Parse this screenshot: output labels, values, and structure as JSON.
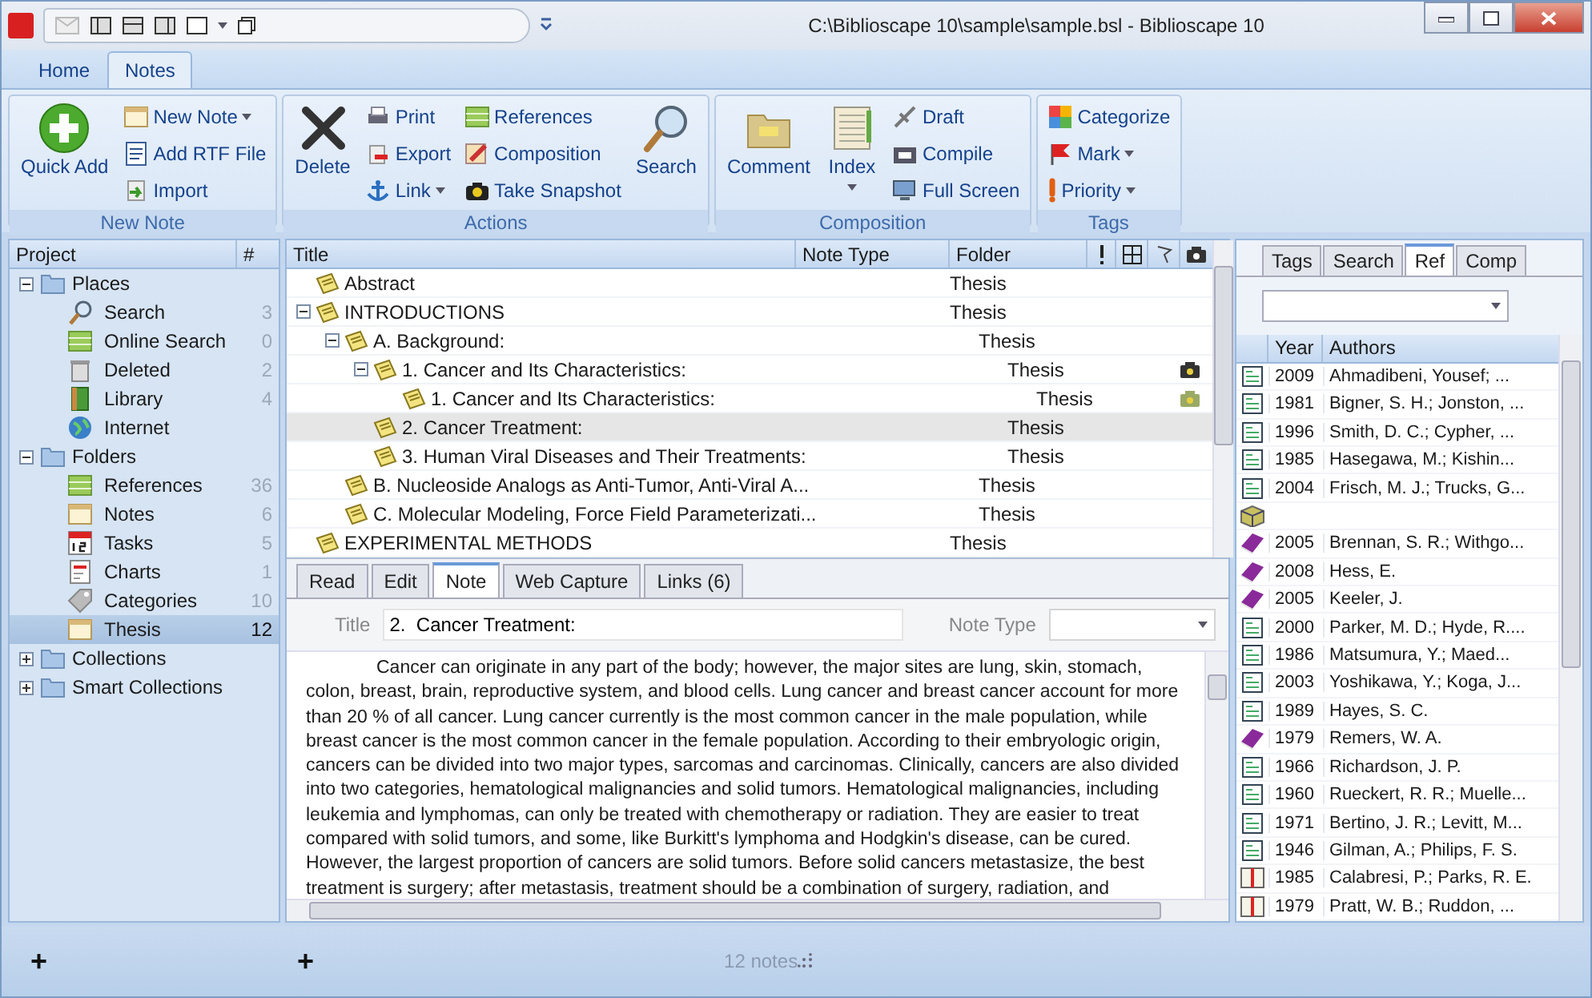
{
  "window": {
    "title": "C:\\Biblioscape 10\\sample\\sample.bsl - Biblioscape 10"
  },
  "ribbon": {
    "tabs": [
      {
        "label": "Home",
        "selected": false
      },
      {
        "label": "Notes",
        "selected": true
      }
    ],
    "groups": [
      {
        "label": "New Note",
        "items": [
          {
            "label": "Quick Add",
            "kind": "large",
            "dropdown": false
          },
          {
            "label": "New Note",
            "kind": "small",
            "dropdown": true
          },
          {
            "label": "Add RTF File",
            "kind": "small",
            "dropdown": false
          },
          {
            "label": "Import",
            "kind": "small",
            "dropdown": false
          }
        ]
      },
      {
        "label": "Actions",
        "items": [
          {
            "label": "Delete",
            "kind": "large",
            "dropdown": false
          },
          {
            "label": "Print",
            "kind": "small",
            "dropdown": false
          },
          {
            "label": "Export",
            "kind": "small",
            "dropdown": false
          },
          {
            "label": "Link",
            "kind": "small",
            "dropdown": true
          },
          {
            "label": "References",
            "kind": "small",
            "dropdown": false
          },
          {
            "label": "Composition",
            "kind": "small",
            "dropdown": false
          },
          {
            "label": "Take Snapshot",
            "kind": "small",
            "dropdown": false
          },
          {
            "label": "Search",
            "kind": "large",
            "dropdown": false
          }
        ]
      },
      {
        "label": "Composition",
        "items": [
          {
            "label": "Comment",
            "kind": "large",
            "dropdown": false
          },
          {
            "label": "Index",
            "kind": "large",
            "dropdown": true
          },
          {
            "label": "Draft",
            "kind": "small",
            "dropdown": false
          },
          {
            "label": "Compile",
            "kind": "small",
            "dropdown": false
          },
          {
            "label": "Full Screen",
            "kind": "small",
            "dropdown": false
          }
        ]
      },
      {
        "label": "Tags",
        "items": [
          {
            "label": "Categorize",
            "kind": "small",
            "dropdown": false
          },
          {
            "label": "Mark",
            "kind": "small",
            "dropdown": true
          },
          {
            "label": "Priority",
            "kind": "small",
            "dropdown": true
          }
        ]
      }
    ]
  },
  "project": {
    "columns": [
      "Project",
      "#"
    ],
    "tree": [
      {
        "label": "Places",
        "expanded": true,
        "children": [
          {
            "label": "Search",
            "kind": "search",
            "count": "3",
            "selected": false
          },
          {
            "label": "Online Search",
            "kind": "online",
            "count": "0",
            "selected": false
          },
          {
            "label": "Deleted",
            "kind": "deleted",
            "count": "2",
            "selected": false
          },
          {
            "label": "Library",
            "kind": "library",
            "count": "4",
            "selected": false
          },
          {
            "label": "Internet",
            "kind": "internet",
            "selected": false
          }
        ]
      },
      {
        "label": "Folders",
        "expanded": true,
        "children": [
          {
            "label": "References",
            "kind": "references",
            "count": "36",
            "selected": false
          },
          {
            "label": "Notes",
            "kind": "notes",
            "count": "6",
            "selected": false
          },
          {
            "label": "Tasks",
            "kind": "tasks",
            "count": "5",
            "selected": false
          },
          {
            "label": "Charts",
            "kind": "charts",
            "count": "1",
            "selected": false
          },
          {
            "label": "Categories",
            "kind": "categories",
            "count": "10",
            "selected": false
          },
          {
            "label": "Thesis",
            "kind": "notes",
            "count": "12",
            "selected": true
          }
        ]
      },
      {
        "label": "Collections",
        "expanded": false
      },
      {
        "label": "Smart Collections",
        "expanded": false
      }
    ]
  },
  "notes_table": {
    "columns": [
      "Title",
      "Note Type",
      "Folder"
    ],
    "rows": [
      {
        "title": "Abstract",
        "folder": "Thesis",
        "selected": false
      },
      {
        "title": "INTRODUCTIONS",
        "folder": "Thesis",
        "selected": false,
        "expanded": true,
        "children": [
          {
            "title": "A.  Background:",
            "folder": "Thesis",
            "selected": false,
            "expanded": true,
            "children": [
              {
                "title": "1.  Cancer and Its Characteristics:",
                "folder": "Thesis",
                "selected": false,
                "snapshot": true,
                "snapshot_dimmed": false,
                "expanded": true,
                "children": [
                  {
                    "title": "1.  Cancer and Its Characteristics:",
                    "folder": "Thesis",
                    "selected": false,
                    "snapshot": true,
                    "snapshot_dimmed": true
                  }
                ]
              },
              {
                "title": "2.  Cancer Treatment:",
                "folder": "Thesis",
                "selected": true
              },
              {
                "title": "3.  Human Viral Diseases and Their Treatments:",
                "folder": "Thesis",
                "selected": false
              }
            ]
          },
          {
            "title": "B.  Nucleoside Analogs as Anti-Tumor, Anti-Viral A...",
            "folder": "Thesis",
            "selected": false
          },
          {
            "title": "C.  Molecular Modeling, Force Field Parameterizati...",
            "folder": "Thesis",
            "selected": false
          }
        ]
      },
      {
        "title": "EXPERIMENTAL METHODS",
        "folder": "Thesis",
        "selected": false
      }
    ]
  },
  "editor": {
    "tabs": [
      {
        "label": "Read",
        "selected": false
      },
      {
        "label": "Edit",
        "selected": false
      },
      {
        "label": "Note",
        "selected": true
      },
      {
        "label": "Web Capture",
        "selected": false
      },
      {
        "label": "Links (6)",
        "selected": false
      }
    ],
    "title_label": "Title",
    "title_value": "2.  Cancer Treatment:",
    "note_type_label": "Note Type",
    "body": "Cancer can originate in any part of the body; however, the major sites are lung, skin, stomach, colon, breast, brain, reproductive system, and blood cells. Lung cancer and breast cancer account for more than 20 % of all cancer. Lung cancer currently is the most common cancer in the male population, while breast cancer is the most common cancer in the female population. According to their embryologic origin, cancers can be divided into two major types, sarcomas and carcinomas. Clinically, cancers are also divided into two categories, hematological malignancies and solid tumors. Hematological malignancies, including leukemia and lymphomas, can only be treated with chemotherapy or radiation. They are easier to treat compared with solid tumors, and some, like Burkitt's lymphoma and Hodgkin's disease, can be cured. However, the largest proportion of cancers are solid tumors. Before solid cancers metastasize, the best treatment is surgery; after metastasis, treatment should be a combination of surgery, radiation, and"
  },
  "ref_panel": {
    "tabs": [
      {
        "label": "Tags",
        "selected": false
      },
      {
        "label": "Search",
        "selected": false
      },
      {
        "label": "Ref",
        "selected": true
      },
      {
        "label": "Comp",
        "selected": false
      }
    ],
    "columns": [
      "Year",
      "Authors"
    ],
    "rows": [
      {
        "kind": "journal",
        "year": "2009",
        "authors": "Ahmadibeni, Yousef; ..."
      },
      {
        "kind": "journal",
        "year": "1981",
        "authors": "Bigner, S. H.; Jonston, ..."
      },
      {
        "kind": "journal",
        "year": "1996",
        "authors": "Smith, D. C.; Cypher, ..."
      },
      {
        "kind": "journal",
        "year": "1985",
        "authors": "Hasegawa, M.; Kishin..."
      },
      {
        "kind": "journal",
        "year": "2004",
        "authors": "Frisch, M. J.; Trucks, G..."
      },
      {
        "kind": "package"
      },
      {
        "kind": "book",
        "year": "2005",
        "authors": "Brennan, S. R.; Withgo..."
      },
      {
        "kind": "book",
        "year": "2008",
        "authors": "Hess, E."
      },
      {
        "kind": "book",
        "year": "2005",
        "authors": "Keeler, J."
      },
      {
        "kind": "journal",
        "year": "2000",
        "authors": "Parker, M. D.; Hyde, R...."
      },
      {
        "kind": "journal",
        "year": "1986",
        "authors": "Matsumura, Y.; Maed..."
      },
      {
        "kind": "journal",
        "year": "2003",
        "authors": "Yoshikawa, Y.; Koga, J..."
      },
      {
        "kind": "journal",
        "year": "1989",
        "authors": "Hayes, S. C."
      },
      {
        "kind": "book",
        "year": "1979",
        "authors": "Remers, W. A."
      },
      {
        "kind": "journal",
        "year": "1966",
        "authors": "Richardson, J. P."
      },
      {
        "kind": "journal",
        "year": "1960",
        "authors": "Rueckert, R. R.; Muelle..."
      },
      {
        "kind": "journal",
        "year": "1971",
        "authors": "Bertino, J. R.; Levitt, M..."
      },
      {
        "kind": "journal",
        "year": "1946",
        "authors": "Gilman, A.; Philips, F. S."
      },
      {
        "kind": "chapter",
        "year": "1985",
        "authors": "Calabresi, P.; Parks, R. E."
      },
      {
        "kind": "chapter",
        "year": "1979",
        "authors": "Pratt, W. B.; Ruddon, ..."
      }
    ]
  },
  "status_bar": {
    "left_button": "+",
    "middle_button": "+",
    "count": "12 notes"
  }
}
